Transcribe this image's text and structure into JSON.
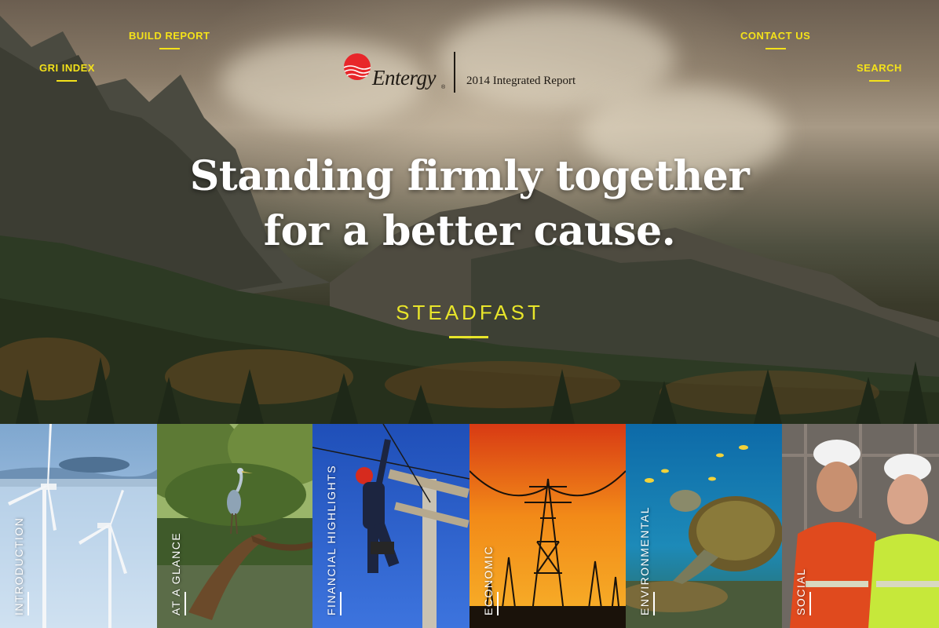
{
  "header": {
    "build_report": "BUILD REPORT",
    "gri_index": "GRI INDEX",
    "contact_us": "CONTACT US",
    "search": "SEARCH"
  },
  "logo": {
    "wordmark": "Entergy",
    "registered": "®",
    "report_title": "2014  Integrated Report"
  },
  "hero": {
    "headline_line1": "Standing firmly together",
    "headline_line2": "for a better cause.",
    "tagline": "STEADFAST"
  },
  "tiles": [
    {
      "label": "INTRODUCTION",
      "image": "wind-turbines"
    },
    {
      "label": "AT A GLANCE",
      "image": "heron-swamp"
    },
    {
      "label": "FINANCIAL HIGHLIGHTS",
      "image": "lineman-pole"
    },
    {
      "label": "ECONOMIC",
      "image": "power-towers-sunset"
    },
    {
      "label": "ENVIRONMENTAL",
      "image": "sea-turtle"
    },
    {
      "label": "SOCIAL",
      "image": "workers-hardhats"
    }
  ],
  "colors": {
    "accent_yellow": "#f4e21a",
    "logo_red": "#e8262a",
    "text_dark": "#1f1a14"
  }
}
